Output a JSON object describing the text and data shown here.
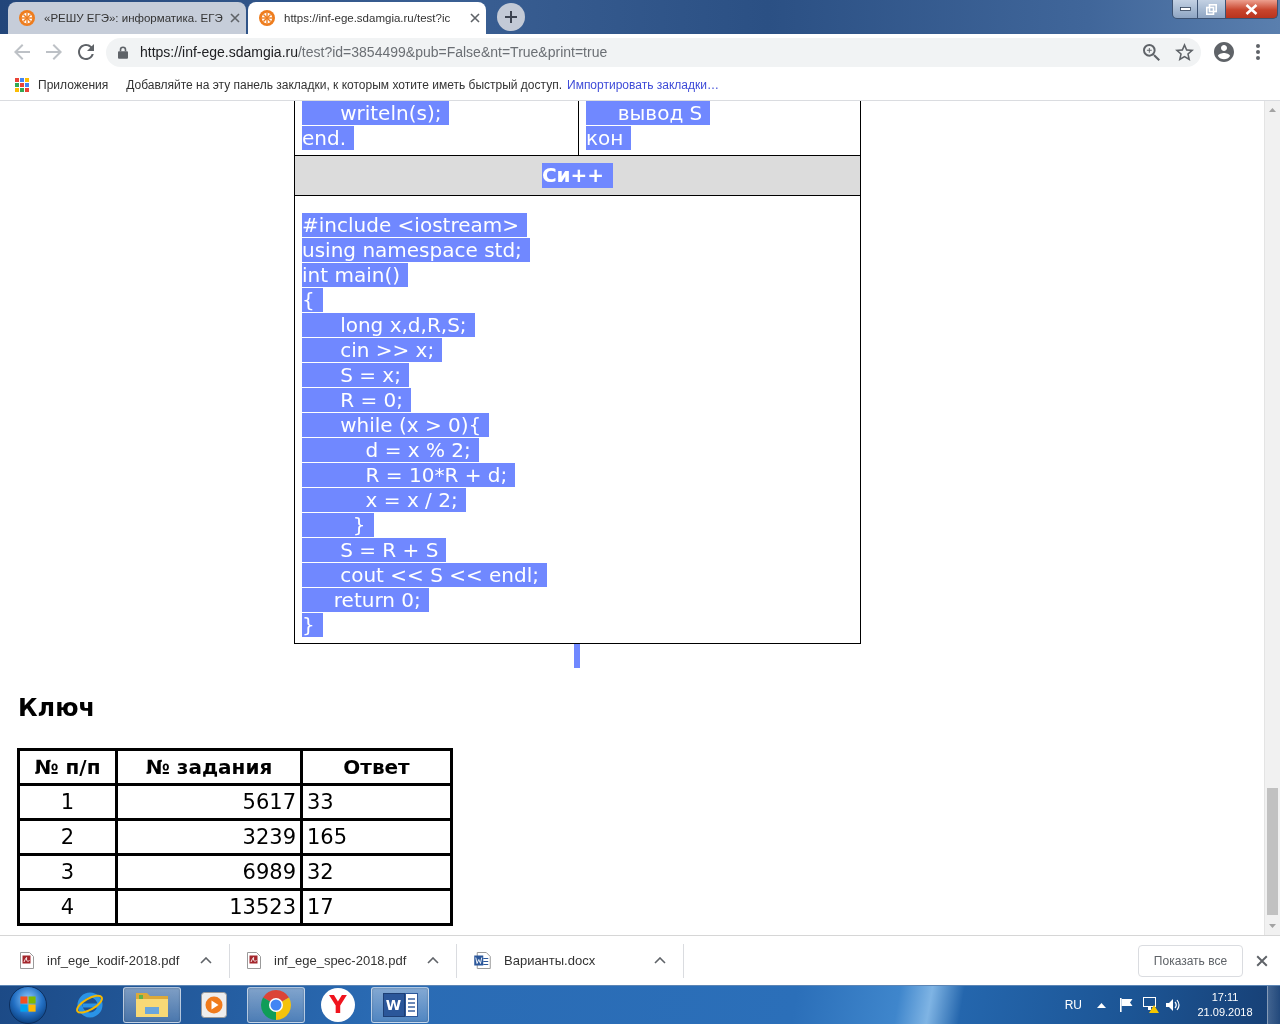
{
  "browser": {
    "tabs": [
      {
        "title": "«РЕШУ ЕГЭ»: информатика. ЕГЭ",
        "selected": false
      },
      {
        "title": "https://inf-ege.sdamgia.ru/test?ic",
        "selected": true
      }
    ],
    "toolbar": {
      "back_disabled": true,
      "forward_disabled": true,
      "url_origin": "https://inf-ege.sdamgia.ru",
      "url_path": "/test?id=3854499&pub=False&nt=True&print=true"
    },
    "bookmarks_bar": {
      "apps_label": "Приложения",
      "hint": "Добавляйте на эту панель закладки, к которым хотите иметь быстрый доступ.",
      "import_link": "Импортировать закладки…"
    }
  },
  "page": {
    "code_table": {
      "selected": true,
      "top_row": [
        [
          "      writeln(s);",
          "end."
        ],
        [
          "     вывод S",
          "кон"
        ]
      ],
      "section_title": "Си++",
      "code_lines": [
        "#include <iostream>",
        "using namespace std;",
        "int main()",
        "{",
        "      long x,d,R,S;",
        "      cin >> x;",
        "      S = x;",
        "      R = 0;",
        "      while (x > 0){",
        "          d = x % 2;",
        "          R = 10*R + d;",
        "          x = x / 2;",
        "        }",
        "      S = R + S",
        "      cout << S << endl;",
        "     return 0;",
        "}"
      ]
    },
    "key": {
      "title": "Ключ",
      "columns": [
        "№ п/п",
        "№ задания",
        "Ответ"
      ],
      "rows": [
        [
          "1",
          "5617",
          "33"
        ],
        [
          "2",
          "3239",
          "165"
        ],
        [
          "3",
          "6989",
          "32"
        ],
        [
          "4",
          "13523",
          "17"
        ]
      ]
    }
  },
  "downloads": {
    "items": [
      {
        "kind": "pdf",
        "name": "inf_ege_kodif-2018.pdf"
      },
      {
        "kind": "pdf",
        "name": "inf_ege_spec-2018.pdf"
      },
      {
        "kind": "docx",
        "name": "Варианты.docx"
      }
    ],
    "show_all": "Показать все"
  },
  "taskbar": {
    "apps": [
      {
        "kind": "ie",
        "running": false
      },
      {
        "kind": "explorer",
        "running": true
      },
      {
        "kind": "media",
        "running": false
      },
      {
        "kind": "chrome",
        "running": true
      },
      {
        "kind": "yandex",
        "running": false,
        "glyph": "Y"
      },
      {
        "kind": "word",
        "running": true,
        "glyph": "W"
      }
    ],
    "language": "RU",
    "time": "17:11",
    "date": "21.09.2018"
  }
}
